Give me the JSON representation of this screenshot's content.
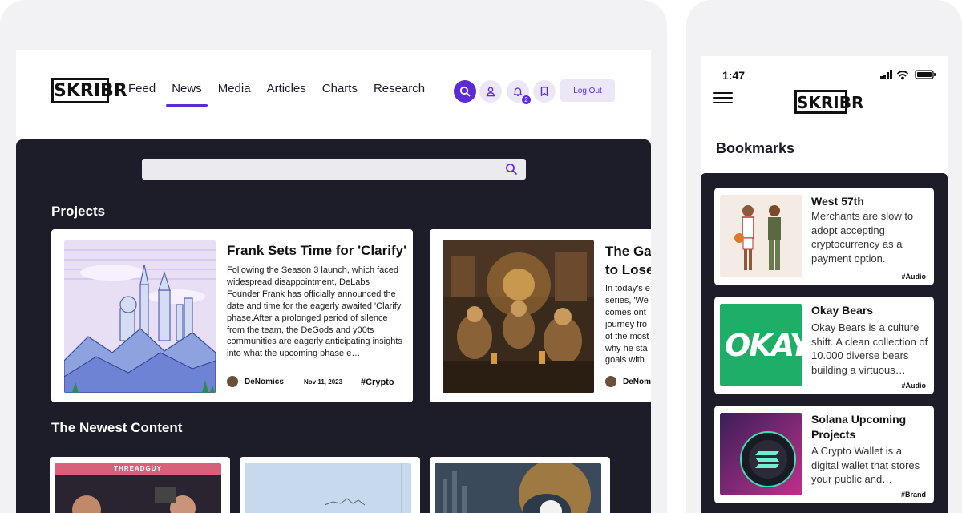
{
  "desktop": {
    "logo": "SKRIBR",
    "nav": [
      "Feed",
      "News",
      "Media",
      "Articles",
      "Charts",
      "Research"
    ],
    "active_nav": "News",
    "notification_count": "2",
    "logout_label": "Log Out",
    "search": {
      "placeholder": ""
    },
    "projects_heading": "Projects",
    "projects": [
      {
        "title": "Frank Sets Time for 'Clarify'",
        "body": "Following the Season 3 launch, which faced widespread disappointment, DeLabs Founder Frank has officially announced the date and time for the eagerly awaited 'Clarify' phase.After a prolonged period of silence from the team, the DeGods and y00ts communities are eagerly anticipating insights into what the upcoming phase e…",
        "author": "DeNomics",
        "date": "Nov 11, 2023",
        "tag": "#Crypto"
      },
      {
        "title": "The Ga… to Lose…",
        "title_line1": "The Ga",
        "title_line2": "to Lose",
        "body_lines": [
          "In today's e",
          "series, 'We",
          "comes ont",
          "journey fro",
          "of the most",
          "why he sta",
          "goals with"
        ],
        "author": "DeNom"
      }
    ],
    "newest_heading": "The Newest Content",
    "newest_labels": [
      "THREADGUY"
    ]
  },
  "phone": {
    "time": "1:47",
    "logo": "SKRIBR",
    "heading": "Bookmarks",
    "bookmarks": [
      {
        "title": "West 57th",
        "body": "Merchants are slow to adopt accepting cryptocurrency as a payment option.",
        "tag": "#Audio"
      },
      {
        "title": "Okay Bears",
        "body": "Okay Bears is a culture shift. A clean collection of 10.000 diverse bears building a virtuous…",
        "tag": "#Audio",
        "image_text": "OKAY"
      },
      {
        "title": "Solana Upcoming Projects",
        "body": "A Crypto Wallet is a digital wallet that stores your public and…",
        "tag": "#Brand"
      }
    ]
  },
  "colors": {
    "accent": "#5b2bd6",
    "dark_panel": "#1d1d29",
    "frame": "#f2f2f5"
  }
}
